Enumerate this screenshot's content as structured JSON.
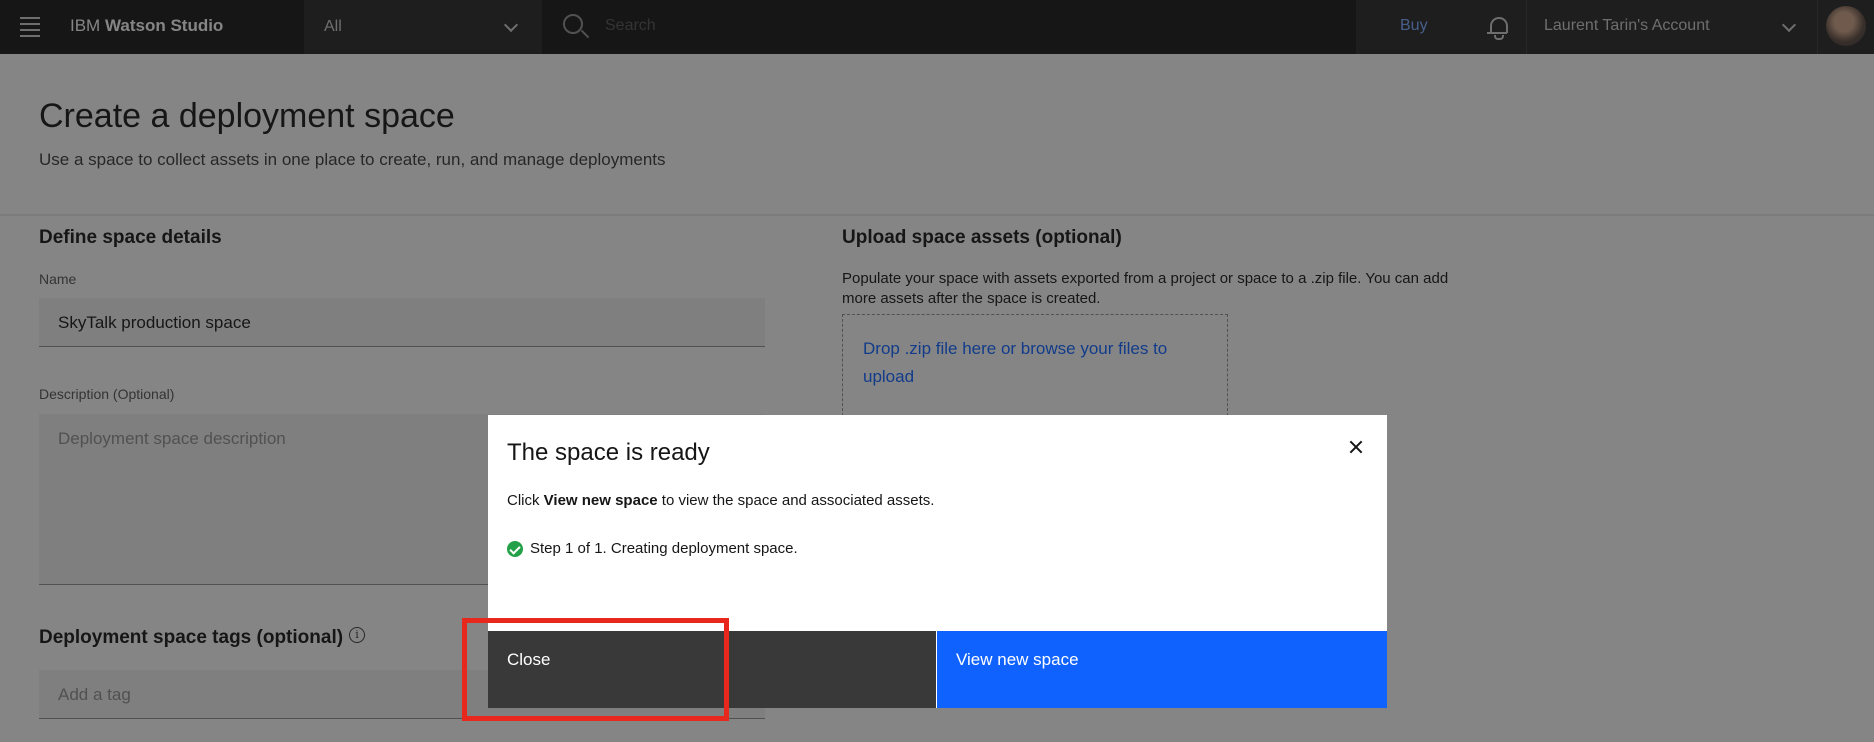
{
  "nav": {
    "brand_prefix": "IBM",
    "brand_name": "Watson Studio",
    "scope": "All",
    "search_placeholder": "Search",
    "buy": "Buy",
    "account": "Laurent Tarin's Account"
  },
  "page": {
    "title": "Create a deployment space",
    "subtitle": "Use a space to collect assets in one place to create, run, and manage deployments"
  },
  "details": {
    "title": "Define space details",
    "name_label": "Name",
    "name_value": "SkyTalk production space",
    "description_label": "Description (Optional)",
    "description_placeholder": "Deployment space description",
    "tags_title": "Deployment space tags (optional)",
    "tags_placeholder": "Add a tag"
  },
  "upload": {
    "title": "Upload space assets (optional)",
    "description": "Populate your space with assets exported from a project or space to a .zip file. You can add more assets after the space is created.",
    "dropzone": "Drop .zip file here or browse your files to upload"
  },
  "modal": {
    "title": "The space is ready",
    "text_prefix": "Click ",
    "text_bold": "View new space",
    "text_suffix": " to view the space and associated assets.",
    "step": "Step 1 of 1. Creating deployment space.",
    "close_button": "Close",
    "primary_button": "View new space"
  },
  "colors": {
    "accent": "#0f62fe",
    "success": "#24a148",
    "highlight": "#e8281d"
  }
}
